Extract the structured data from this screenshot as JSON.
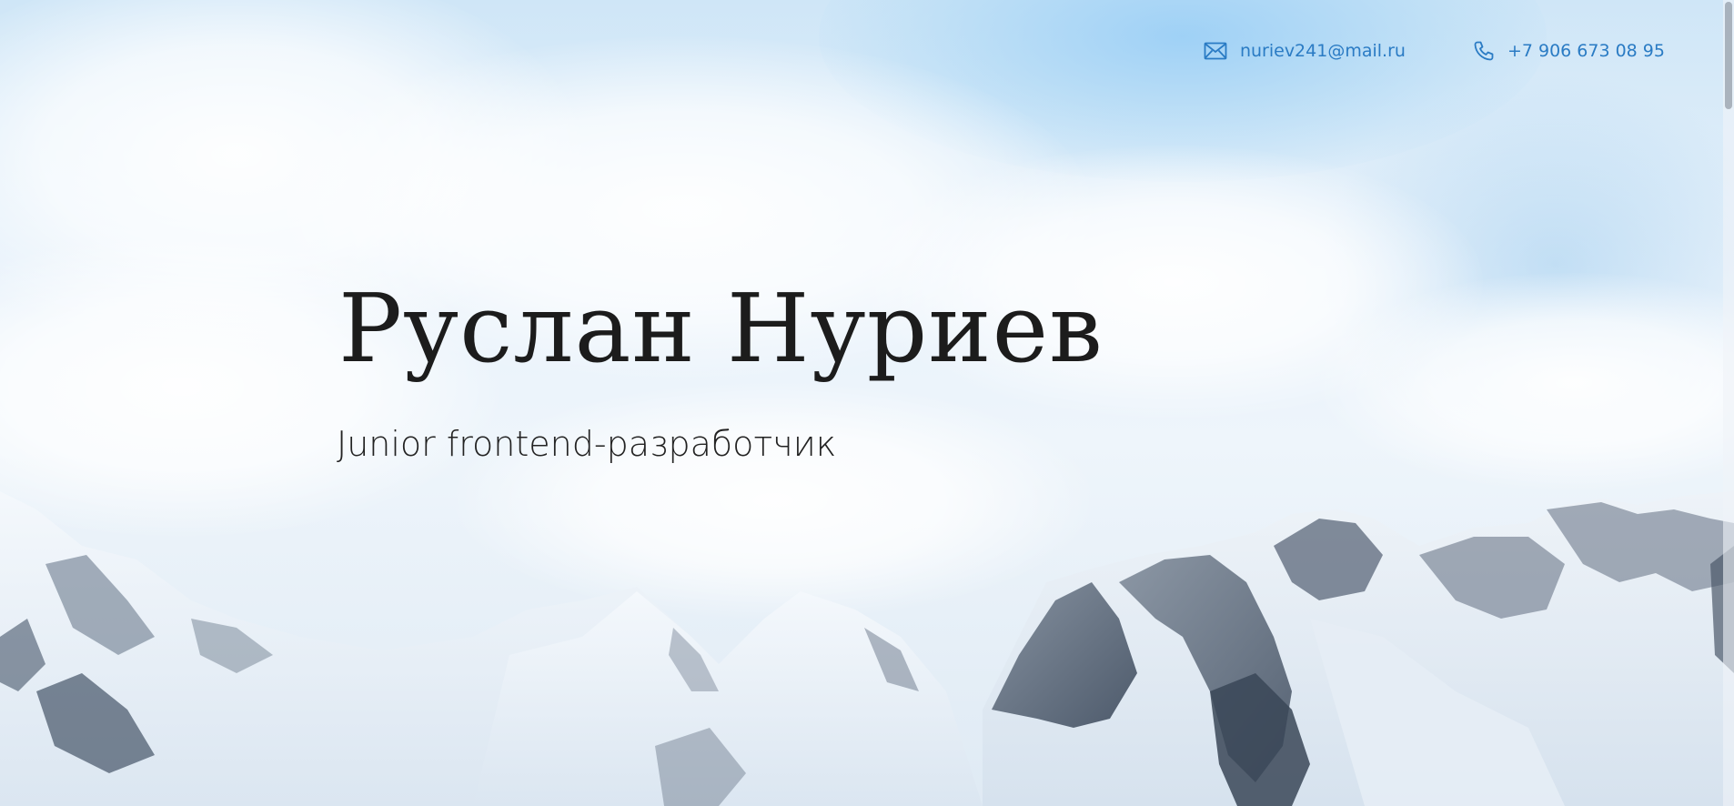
{
  "header": {
    "email": {
      "icon": "mail-icon",
      "text": "nuriev241@mail.ru"
    },
    "phone": {
      "icon": "phone-icon",
      "text": "+7 906 673 08 95"
    }
  },
  "hero": {
    "name": "Руслан Нуриев",
    "role": "Junior frontend-разработчик"
  },
  "colors": {
    "accent": "#2a7bc4",
    "text": "#1c1c1c"
  }
}
